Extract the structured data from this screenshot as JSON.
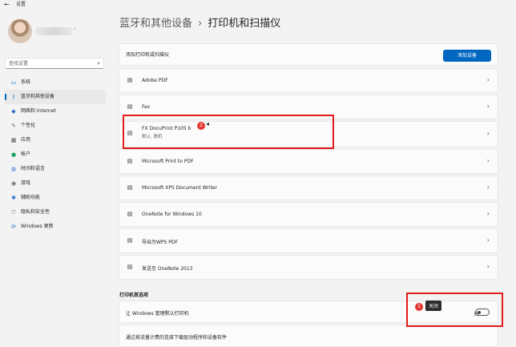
{
  "window": {
    "title": "设置",
    "back_icon": "back-arrow-icon"
  },
  "user": {
    "name_placeholder": "·"
  },
  "search": {
    "placeholder": "查找设置",
    "icon": "search-icon"
  },
  "nav": [
    {
      "label": "系统",
      "icon": "monitor-icon"
    },
    {
      "label": "蓝牙和其他设备",
      "icon": "bluetooth-icon",
      "active": true
    },
    {
      "label": "网络和 Internet",
      "icon": "wifi-icon"
    },
    {
      "label": "个性化",
      "icon": "brush-icon"
    },
    {
      "label": "应用",
      "icon": "apps-icon"
    },
    {
      "label": "帐户",
      "icon": "person-icon"
    },
    {
      "label": "时间和语言",
      "icon": "globe-icon"
    },
    {
      "label": "游戏",
      "icon": "gamepad-icon"
    },
    {
      "label": "辅助功能",
      "icon": "accessibility-icon"
    },
    {
      "label": "隐私和安全性",
      "icon": "shield-icon"
    },
    {
      "label": "Windows 更新",
      "icon": "update-icon"
    }
  ],
  "breadcrumb": {
    "parent": "蓝牙和其他设备",
    "separator": "›",
    "current": "打印机和扫描仪"
  },
  "add_device": {
    "label": "添加打印机或扫描仪",
    "button": "添加设备"
  },
  "printers": [
    {
      "name": "Adobe PDF",
      "sub": ""
    },
    {
      "name": "Fax",
      "sub": ""
    },
    {
      "name": "FX DocuPrint P105 b",
      "sub": "默认, 脱机"
    },
    {
      "name": "Microsoft Print to PDF",
      "sub": ""
    },
    {
      "name": "Microsoft XPS Document Writer",
      "sub": ""
    },
    {
      "name": "OneNote for Windows 10",
      "sub": ""
    },
    {
      "name": "导出为WPS PDF",
      "sub": ""
    },
    {
      "name": "发送至 OneNote 2013",
      "sub": ""
    }
  ],
  "preferences": {
    "title": "打印机首选项",
    "manage_default": {
      "label": "让 Windows 管理默认打印机",
      "state": "关"
    },
    "metered": {
      "label": "通过按流量计费的连接下载驱动程序和设备软件"
    }
  },
  "annotations": {
    "badge1": "1",
    "badge2": "2",
    "tooltip": "关闭",
    "highlight_color": "#e21b1b"
  },
  "colors": {
    "accent": "#0067c0",
    "background": "#f3f3f3",
    "card": "#fbfbfb"
  }
}
